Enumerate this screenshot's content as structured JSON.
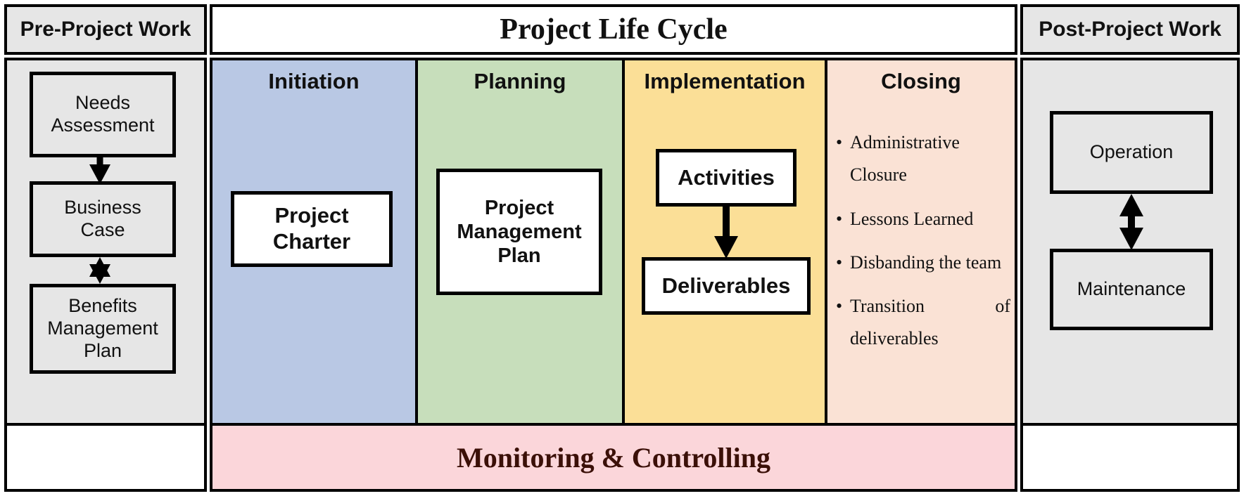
{
  "headers": {
    "pre_project": "Pre-Project Work",
    "life_cycle": "Project Life Cycle",
    "post_project": "Post-Project Work"
  },
  "phases": {
    "initiation": "Initiation",
    "planning": "Planning",
    "implementation": "Implementation",
    "closing": "Closing"
  },
  "pre_project_nodes": {
    "needs": "Needs\nAssessment",
    "needs_line1": "Needs",
    "needs_line2": "Assessment",
    "business_line1": "Business",
    "business_line2": "Case",
    "benefits_line1": "Benefits",
    "benefits_line2": "Management",
    "benefits_line3": "Plan"
  },
  "initiation_nodes": {
    "charter_line1": "Project",
    "charter_line2": "Charter"
  },
  "planning_nodes": {
    "pmplan_line1": "Project",
    "pmplan_line2": "Management",
    "pmplan_line3": "Plan"
  },
  "implementation_nodes": {
    "activities": "Activities",
    "deliverables": "Deliverables"
  },
  "closing_bullets": [
    "Administrative Closure",
    "Lessons Learned",
    "Disbanding the team",
    "Transition of deliverables"
  ],
  "post_project_nodes": {
    "operation": "Operation",
    "maintenance": "Maintenance"
  },
  "footer": {
    "monitoring": "Monitoring & Controlling"
  },
  "colors": {
    "initiation_bg": "#b9c8e4",
    "planning_bg": "#c7debb",
    "implementation_bg": "#fbdf97",
    "closing_bg": "#fae2d5",
    "monitoring_bg": "#fbd6da",
    "monitoring_text": "#3b1008",
    "side_panel_bg": "#e6e6e6",
    "border": "#000000"
  }
}
